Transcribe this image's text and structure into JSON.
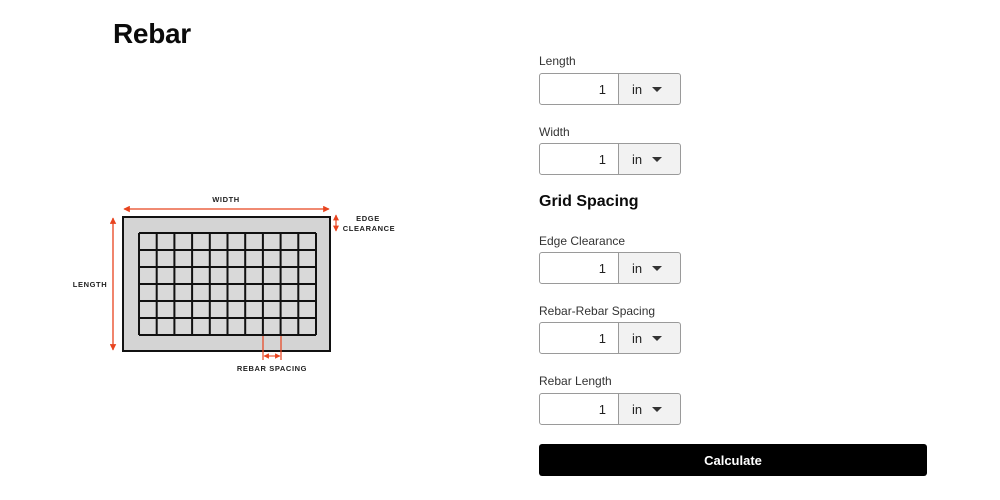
{
  "page": {
    "title": "Rebar"
  },
  "diagram": {
    "label_width": "WIDTH",
    "label_length": "LENGTH",
    "label_edge": "EDGE",
    "label_clearance": "CLEARANCE",
    "label_rebar_spacing": "REBAR SPACING",
    "colors": {
      "arrow": "#e8431e",
      "slab_fill": "#d4d4d4",
      "grid_line": "#111111"
    }
  },
  "form": {
    "length": {
      "label": "Length",
      "value": "1",
      "unit": "in"
    },
    "width": {
      "label": "Width",
      "value": "1",
      "unit": "in"
    },
    "grid_heading": "Grid Spacing",
    "edge_clearance": {
      "label": "Edge Clearance",
      "value": "1",
      "unit": "in"
    },
    "rebar_spacing": {
      "label": "Rebar-Rebar Spacing",
      "value": "1",
      "unit": "in"
    },
    "rebar_length": {
      "label": "Rebar Length",
      "value": "1",
      "unit": "in"
    },
    "calculate_label": "Calculate"
  }
}
